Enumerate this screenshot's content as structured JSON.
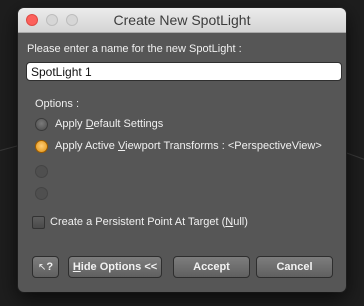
{
  "window": {
    "title": "Create New SpotLight"
  },
  "form": {
    "prompt": "Please enter a name for the new SpotLight :",
    "name_value": "SpotLight 1",
    "options_label": "Options :",
    "radio_options": [
      {
        "pre": "Apply ",
        "key": "D",
        "post": "efault Settings",
        "checked": false,
        "enabled": true
      },
      {
        "pre": "Apply Active ",
        "key": "V",
        "post": "iewport Transforms : <PerspectiveView>",
        "checked": true,
        "enabled": true
      },
      {
        "label": "",
        "checked": false,
        "enabled": false
      },
      {
        "label": "",
        "checked": false,
        "enabled": false
      }
    ],
    "checkbox": {
      "pre": "Create a Persistent Point At Target (",
      "key": "N",
      "post": "ull)",
      "checked": false
    }
  },
  "buttons": {
    "help": "?",
    "hide_options": {
      "key": "H",
      "post": "ide Options <<"
    },
    "accept": "Accept",
    "cancel": "Cancel"
  },
  "colors": {
    "dialog_bg": "#565656",
    "accent_radio": "#f0a020",
    "close_button": "#fc605b"
  }
}
